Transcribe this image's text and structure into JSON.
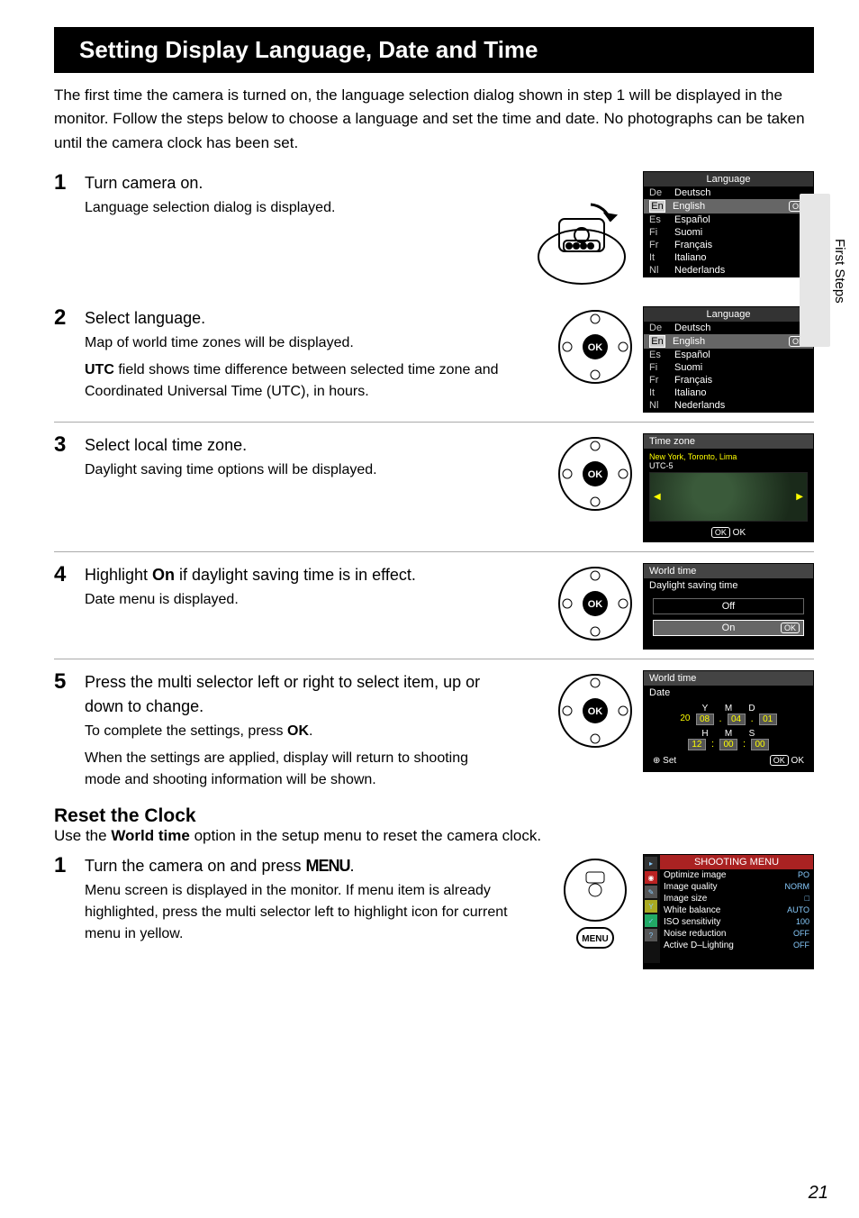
{
  "section_title": "Setting Display Language, Date and Time",
  "intro": "The first time the camera is turned on, the language selection dialog shown in step 1 will be displayed in the monitor. Follow the steps below to choose a language and set the time and date. No photographs can be taken until the camera clock has been set.",
  "side_label": "First Steps",
  "steps": {
    "s1": {
      "num": "1",
      "title": "Turn camera on.",
      "body1": "Language selection dialog is displayed."
    },
    "s2": {
      "num": "2",
      "title": "Select language.",
      "body1": "Map of world time zones will be displayed.",
      "body2_pre": "UTC",
      "body2_post": " field shows time difference between selected time zone and Coordinated Universal Time (UTC), in hours."
    },
    "s3": {
      "num": "3",
      "title": "Select local time zone.",
      "body1": "Daylight saving time options will be displayed."
    },
    "s4": {
      "num": "4",
      "title_pre": "Highlight ",
      "title_bold": "On",
      "title_post": " if daylight saving time is in effect.",
      "body1": "Date menu is displayed."
    },
    "s5": {
      "num": "5",
      "title": "Press the multi selector left or right to select item, up or down to change.",
      "body1_pre": "To complete the settings, press ",
      "body1_btn": "OK",
      "body1_post": ".",
      "body2": "When the settings are applied, display will return to shooting mode and shooting information will be shown."
    }
  },
  "reset": {
    "heading": "Reset the Clock",
    "text_pre": "Use the ",
    "text_bold": "World time",
    "text_post": " option in the setup menu to reset the camera clock.",
    "s1": {
      "num": "1",
      "title_pre": "Turn the camera on and press ",
      "title_btn": "MENU",
      "title_post": ".",
      "body1": "Menu screen is displayed in the monitor. If menu item is already highlighted, press the multi selector left to highlight icon for current menu in yellow."
    }
  },
  "lcd_lang": {
    "title": "Language",
    "items": [
      {
        "code": "De",
        "name": "Deutsch"
      },
      {
        "code": "En",
        "name": "English"
      },
      {
        "code": "Es",
        "name": "Español"
      },
      {
        "code": "Fi",
        "name": "Suomi"
      },
      {
        "code": "Fr",
        "name": "Français"
      },
      {
        "code": "It",
        "name": "Italiano"
      },
      {
        "code": "Nl",
        "name": "Nederlands"
      }
    ],
    "ok": "OK"
  },
  "lcd_tz": {
    "title": "Time zone",
    "loc": "New York, Toronto, Lima",
    "utc": "UTC-5",
    "ok": "OK",
    "ok_label": "OK"
  },
  "lcd_dst": {
    "title": "World time",
    "sub": "Daylight saving time",
    "off": "Off",
    "on": "On",
    "ok": "OK"
  },
  "lcd_date": {
    "title": "World time",
    "sub": "Date",
    "ymd": {
      "y": "Y",
      "m": "M",
      "d": "D",
      "vy": "2008",
      "vm": "04",
      "vd": "01"
    },
    "hms": {
      "h": "H",
      "m": "M",
      "s": "S",
      "vh": "12",
      "vm": "00",
      "vs": "00"
    },
    "set": "Set",
    "ok": "OK",
    "ok_label": "OK"
  },
  "lcd_shoot": {
    "title": "SHOOTING MENU",
    "rows": [
      {
        "k": "Optimize image",
        "v": "PO"
      },
      {
        "k": "Image quality",
        "v": "NORM"
      },
      {
        "k": "Image size",
        "v": "□"
      },
      {
        "k": "White balance",
        "v": "AUTO"
      },
      {
        "k": "ISO sensitivity",
        "v": "100"
      },
      {
        "k": "Noise reduction",
        "v": "OFF"
      },
      {
        "k": "Active D–Lighting",
        "v": "OFF"
      }
    ]
  },
  "page_num": "21"
}
